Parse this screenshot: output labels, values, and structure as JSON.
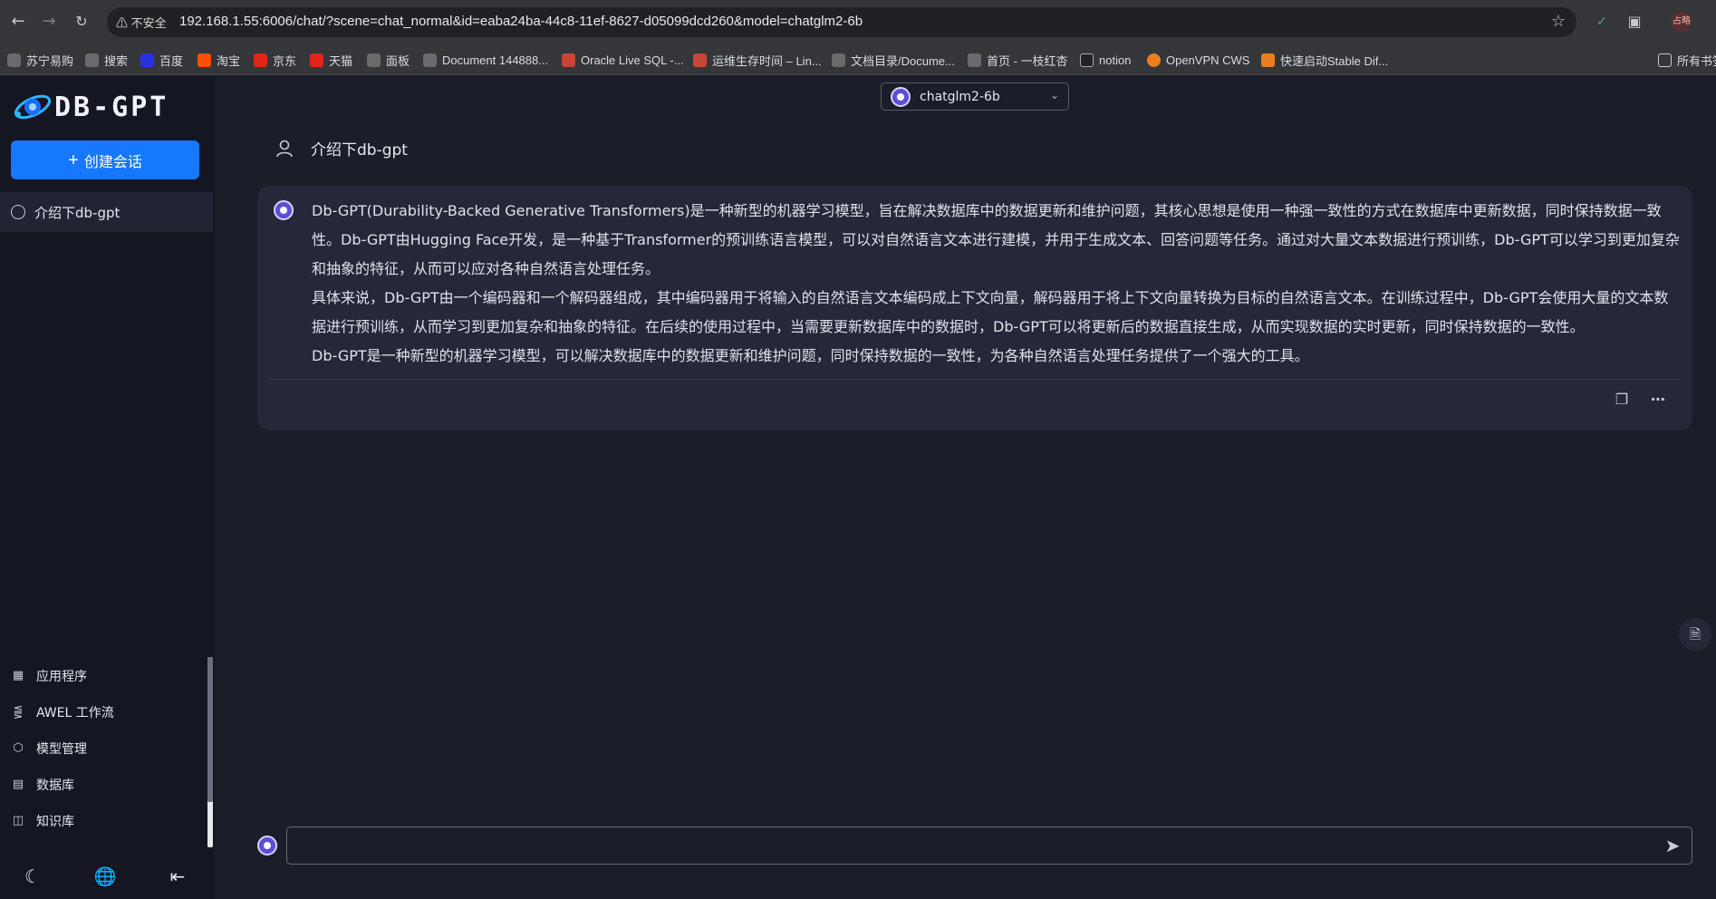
{
  "browser": {
    "security_label": "不安全",
    "url": "192.168.1.55:6006/chat/?scene=chat_normal&id=eaba24ba-44c8-11ef-8627-d05099dcd260&model=chatglm2-6b",
    "profile_label": "占略",
    "bookmarks": [
      {
        "label": "苏宁易购",
        "color": "#6a6a6a"
      },
      {
        "label": "搜索",
        "color": "#6a6a6a"
      },
      {
        "label": "百度",
        "color": "#2932e1"
      },
      {
        "label": "淘宝",
        "color": "#ff5000"
      },
      {
        "label": "京东",
        "color": "#e1251b"
      },
      {
        "label": "天猫",
        "color": "#e1251b"
      },
      {
        "label": "面板",
        "color": "#6a6a6a"
      },
      {
        "label": "Document 144888...",
        "color": "#6a6a6a"
      },
      {
        "label": "Oracle Live SQL -...",
        "color": "#c74634"
      },
      {
        "label": "运维生存时间 – Lin...",
        "color": "#c74634"
      },
      {
        "label": "文档目录/Docume...",
        "color": "#6a6a6a"
      },
      {
        "label": "首页 - 一枝红杏",
        "color": "#6a6a6a"
      },
      {
        "label": "notion",
        "color": "#222222"
      },
      {
        "label": "OpenVPN CWS",
        "color": "#ea7e20"
      },
      {
        "label": "快速启动Stable Dif...",
        "color": "#ea7e20"
      }
    ],
    "all_bookmarks": "所有书签"
  },
  "sidebar": {
    "logo_text": "DB-GPT",
    "new_chat_label": "创建会话",
    "conversations": [
      {
        "label": "介绍下db-gpt"
      }
    ],
    "menu": [
      {
        "label": "应用程序",
        "icon": "apps-icon"
      },
      {
        "label": "AWEL 工作流",
        "icon": "flow-icon"
      },
      {
        "label": "模型管理",
        "icon": "model-icon"
      },
      {
        "label": "数据库",
        "icon": "database-icon"
      },
      {
        "label": "知识库",
        "icon": "knowledge-icon"
      }
    ]
  },
  "main": {
    "model_name": "chatglm2-6b",
    "user_question": "介绍下db-gpt",
    "answer_paragraphs": [
      "Db-GPT(Durability-Backed Generative Transformers)是一种新型的机器学习模型，旨在解决数据库中的数据更新和维护问题，其核心思想是使用一种强一致性的方式在数据库中更新数据，同时保持数据一致性。Db-GPT由Hugging Face开发，是一种基于Transformer的预训练语言模型，可以对自然语言文本进行建模，并用于生成文本、回答问题等任务。通过对大量文本数据进行预训练，Db-GPT可以学习到更加复杂和抽象的特征，从而可以应对各种自然语言处理任务。",
      "具体来说，Db-GPT由一个编码器和一个解码器组成，其中编码器用于将输入的自然语言文本编码成上下文向量，解码器用于将上下文向量转换为目标的自然语言文本。在训练过程中，Db-GPT会使用大量的文本数据进行预训练，从而学习到更加复杂和抽象的特征。在后续的使用过程中，当需要更新数据库中的数据时，Db-GPT可以将更新后的数据直接生成，从而实现数据的实时更新，同时保持数据的一致性。",
      "Db-GPT是一种新型的机器学习模型，可以解决数据库中的数据更新和维护问题，同时保持数据的一致性，为各种自然语言处理任务提供了一个强大的工具。"
    ],
    "input_value": "",
    "accent_color": "#1677ff"
  }
}
